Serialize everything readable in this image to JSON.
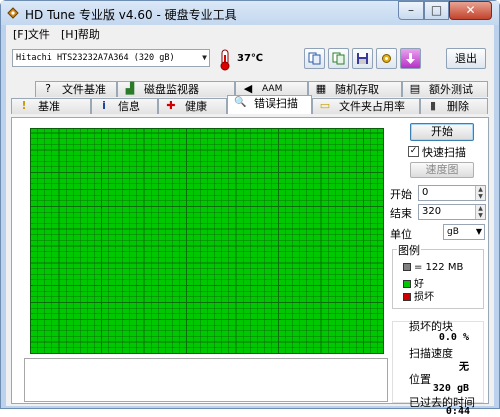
{
  "window": {
    "title": "HD Tune 专业版 v4.60 - 硬盘专业工具"
  },
  "window_controls": {
    "minimize": "–",
    "maximize": "□",
    "close": "✕"
  },
  "menu": [
    {
      "label": "[F]文件"
    },
    {
      "label": "[H]帮助"
    }
  ],
  "toolbar": {
    "drive": "Hitachi HTS23232A7A364 (320 gB)",
    "temperature": "37℃",
    "exit_label": "退出"
  },
  "tabs_top": [
    {
      "label": "文件基准",
      "icon": "file-benchmark-icon",
      "glyph": "?"
    },
    {
      "label": "磁盘监视器",
      "icon": "disk-monitor-icon",
      "glyph": "▟"
    },
    {
      "label": "AAM",
      "icon": "speaker-icon",
      "glyph": "◀"
    },
    {
      "label": "随机存取",
      "icon": "random-access-icon",
      "glyph": "▦"
    },
    {
      "label": "额外测试",
      "icon": "extra-tests-icon",
      "glyph": "▤"
    }
  ],
  "tabs_bottom": [
    {
      "label": "基准",
      "icon": "benchmark-icon",
      "glyph": "!"
    },
    {
      "label": "信息",
      "icon": "info-icon",
      "glyph": "i"
    },
    {
      "label": "健康",
      "icon": "health-icon",
      "glyph": "✚"
    },
    {
      "label": "错误扫描",
      "icon": "error-scan-icon",
      "glyph": "🔍"
    },
    {
      "label": "文件夹占用率",
      "icon": "folder-usage-icon",
      "glyph": "▭"
    },
    {
      "label": "删除",
      "icon": "erase-icon",
      "glyph": "▮"
    }
  ],
  "error_scan": {
    "start_label": "开始",
    "quick_scan_label": "快速扫描",
    "quick_scan_checked": true,
    "speed_map_label": "速度图",
    "start_field_label": "开始",
    "start_value": "0",
    "end_field_label": "结束",
    "end_value": "320",
    "unit_label": "单位",
    "unit_value": "gB",
    "legend_title": "图例",
    "legend": [
      {
        "text": "= 122 MB",
        "color": "#7f7f7f"
      },
      {
        "text": "好",
        "color": "#00c800"
      },
      {
        "text": "损坏",
        "color": "#cc0000"
      }
    ],
    "stats": {
      "damaged_label": "损坏的块",
      "damaged_value": "0.0 %",
      "speed_label": "扫描速度",
      "speed_value": "无",
      "position_label": "位置",
      "position_value": "320 gB",
      "elapsed_label": "已过去的时间",
      "elapsed_value": "0:44"
    },
    "scan_progress_percent": 100
  }
}
